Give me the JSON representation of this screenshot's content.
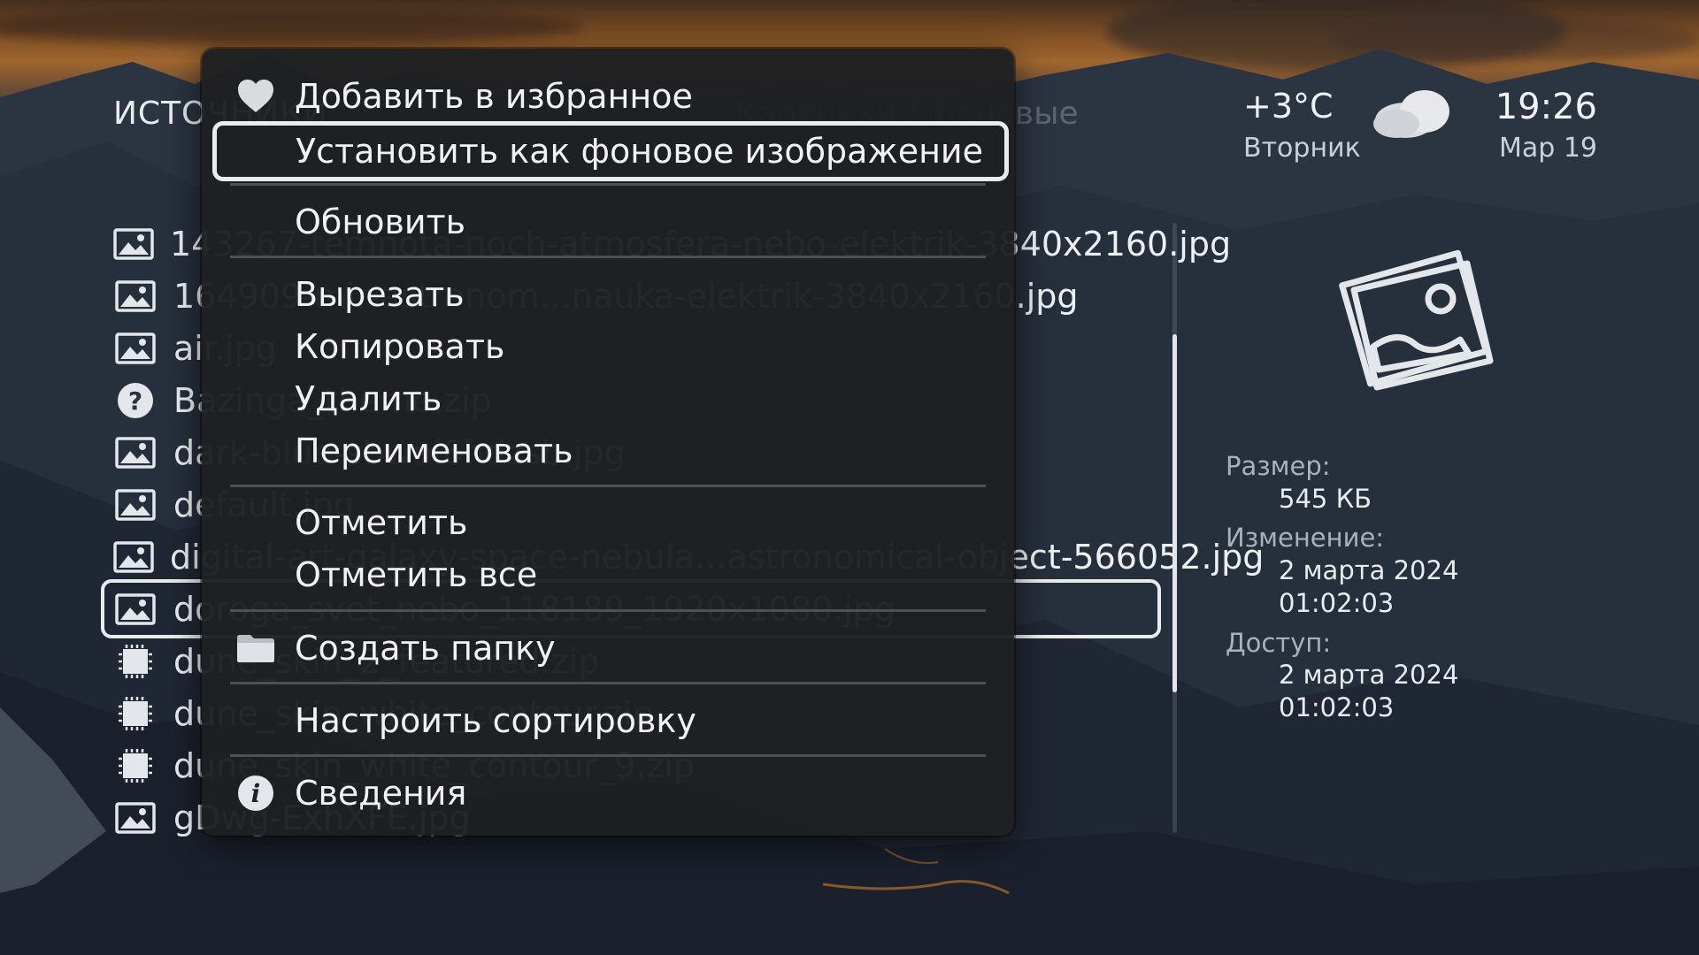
{
  "header": {
    "source_title": "ИСТОЧНИКИ",
    "path_title": "Картинки / фоновые"
  },
  "weather": {
    "temperature": "+3°C",
    "day": "Вторник",
    "icon": "cloud-icon"
  },
  "clock": {
    "time": "19:26",
    "date": "Мар 19"
  },
  "files": [
    {
      "icon": "image-icon",
      "name": "143267-temnota-noch-atmosfera-nebo-elektrik-3840x2160.jpg"
    },
    {
      "icon": "image-icon",
      "name": "164909-mir-astronom...nauka-elektrik-3840x2160.jpg"
    },
    {
      "icon": "image-icon",
      "name": "air.jpg"
    },
    {
      "icon": "unknown-file-icon",
      "name": "Bazinga_theme.zip"
    },
    {
      "icon": "image-icon",
      "name": "dark-blue-sbwoi6hdzsb.jpg"
    },
    {
      "icon": "image-icon",
      "name": "default.jpg"
    },
    {
      "icon": "image-icon",
      "name": "digital-art-galaxy-space-nebula...astronomical-object-566052.jpg"
    },
    {
      "icon": "image-icon",
      "name": "doroga_svet_nebo_118189_1920x1080.jpg"
    },
    {
      "icon": "archive-icon",
      "name": "dune_skin_2_featured.zip"
    },
    {
      "icon": "archive-icon",
      "name": "dune_skin_white_contour.zip"
    },
    {
      "icon": "archive-icon",
      "name": "dune_skin_white_contour_9.zip"
    },
    {
      "icon": "image-icon",
      "name": "gDwg-ExhXFE.jpg"
    }
  ],
  "focused_file_index": 7,
  "scroll_position": 0.2,
  "info": {
    "size_label": "Размер:",
    "size_value": "545 КБ",
    "modified_label": "Изменение:",
    "modified_date": "2 марта 2024",
    "modified_time": "01:02:03",
    "access_label": "Доступ:",
    "access_date": "2 марта 2024",
    "access_time": "01:02:03"
  },
  "menu": {
    "items": [
      {
        "label": "Добавить в избранное",
        "icon": "heart-icon"
      },
      {
        "label": "Установить как фоновое изображение",
        "icon": ""
      },
      {
        "label": "Обновить",
        "icon": ""
      },
      {
        "label": "Вырезать",
        "icon": ""
      },
      {
        "label": "Копировать",
        "icon": ""
      },
      {
        "label": "Удалить",
        "icon": ""
      },
      {
        "label": "Переименовать",
        "icon": ""
      },
      {
        "label": "Отметить",
        "icon": ""
      },
      {
        "label": "Отметить все",
        "icon": ""
      },
      {
        "label": "Создать папку",
        "icon": "folder-icon"
      },
      {
        "label": "Настроить сортировку",
        "icon": ""
      },
      {
        "label": "Сведения",
        "icon": "info-icon"
      }
    ],
    "selected_index": 1
  },
  "colors": {
    "menu_bg": "#1e2023",
    "focus_border": "#e9ecef",
    "separator": "#4d5157",
    "sky_orange": "#d98a3a"
  }
}
